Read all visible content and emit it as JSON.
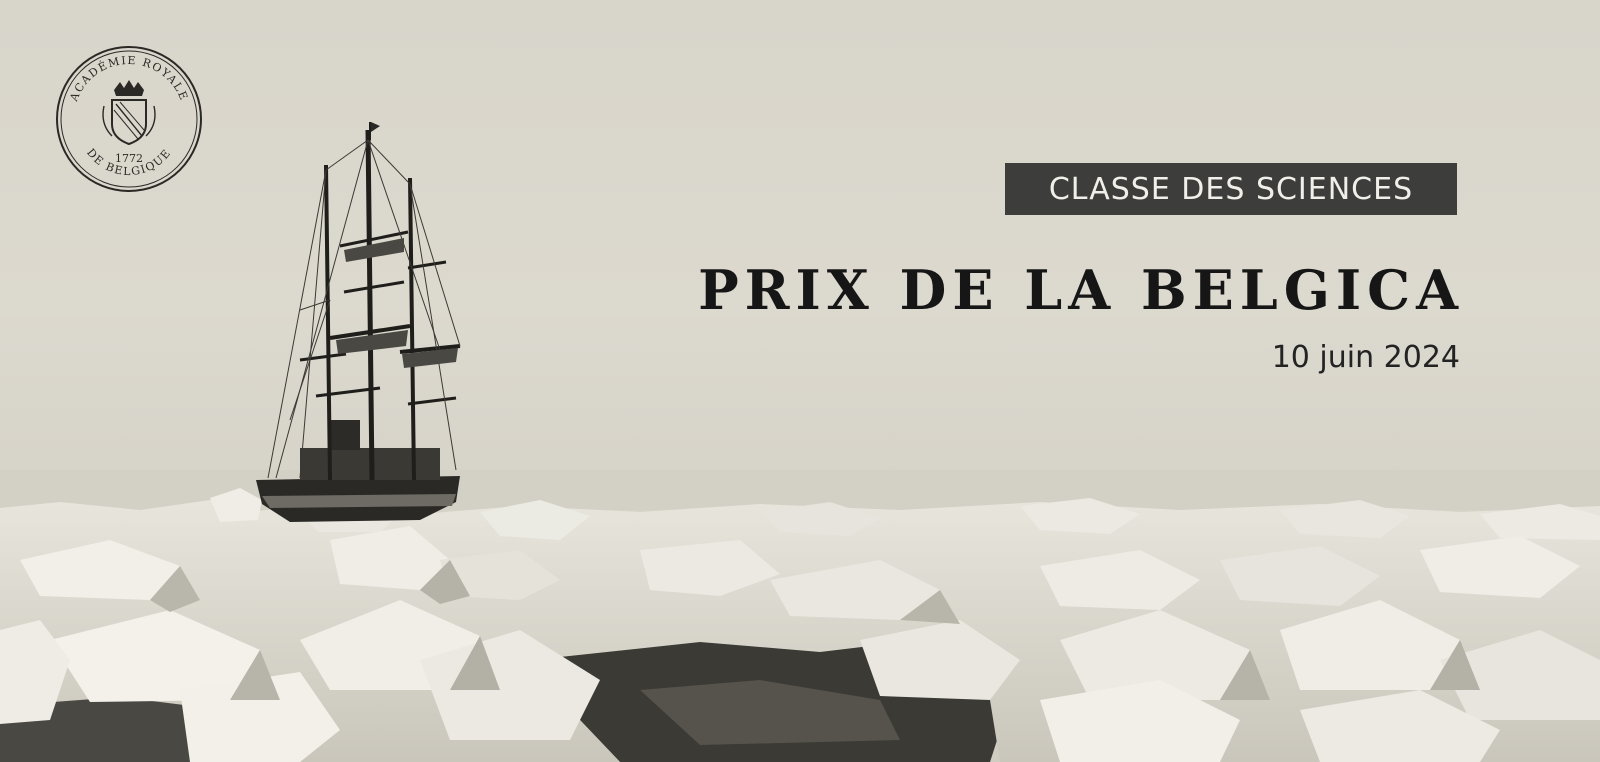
{
  "seal": {
    "arc_top": "ACADÉMIE ROYALE",
    "arc_bottom": "DE BELGIQUE",
    "year": "1772"
  },
  "banner": {
    "category": "CLASSE DES SCIENCES",
    "title": "PRIX DE LA BELGICA",
    "date": "10 juin 2024"
  },
  "photo": {
    "subject": "ship",
    "setting": "pack-ice"
  },
  "colors": {
    "sky": "#d8d5cb",
    "ice": "#ebe9e1",
    "water": "#3b3a35",
    "tag_background": "#3d3d3b",
    "title_text": "#161616"
  }
}
